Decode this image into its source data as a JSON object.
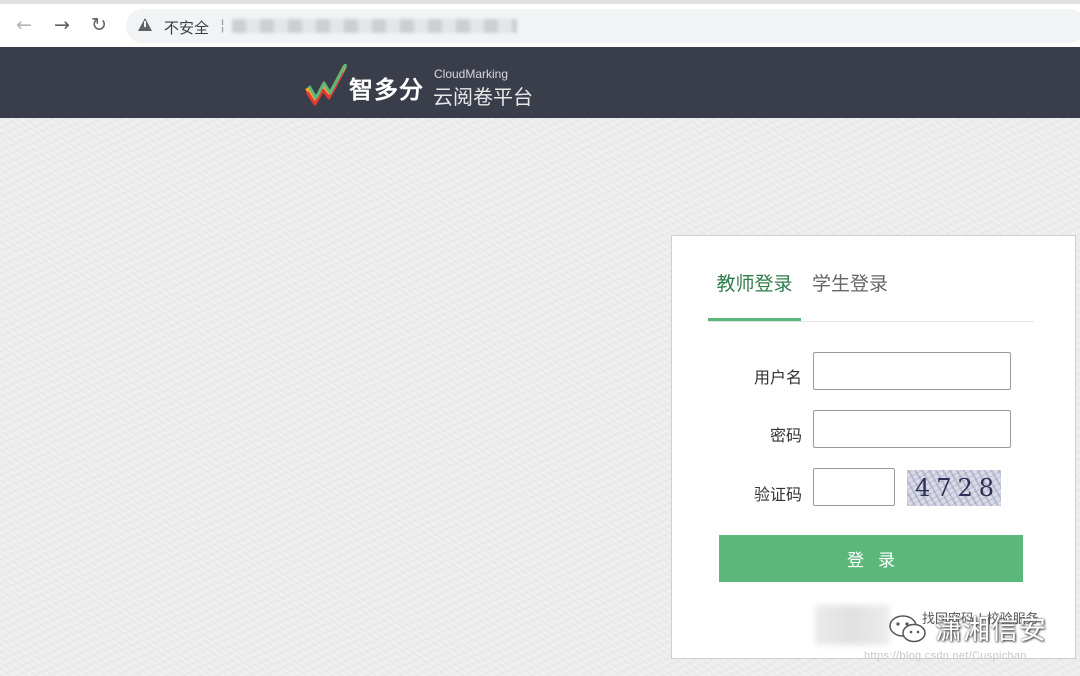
{
  "browser": {
    "security_label": "不安全",
    "separator": "¦"
  },
  "header": {
    "brand_name": "智多分",
    "brand_en": "CloudMarking",
    "brand_sub": "云阅卷平台",
    "colors": {
      "bar": "#3a3e4a",
      "logo_green": "#5cb87a",
      "logo_red": "#e53935",
      "logo_yellow": "#f9a825"
    }
  },
  "login": {
    "tabs": [
      {
        "label": "教师登录",
        "active": true
      },
      {
        "label": "学生登录",
        "active": false
      }
    ],
    "fields": {
      "username_label": "用户名",
      "username_value": "",
      "password_label": "密码",
      "password_value": "",
      "captcha_label": "验证码",
      "captcha_value": "",
      "captcha_image_text": "4728"
    },
    "submit_label": "登录",
    "footer_link": "找回密码 | 校验服务",
    "accent_color": "#5cb87a"
  },
  "watermark": {
    "name": "潇湘信安",
    "url": "https://blog.csdn.net/Cuspichan"
  }
}
